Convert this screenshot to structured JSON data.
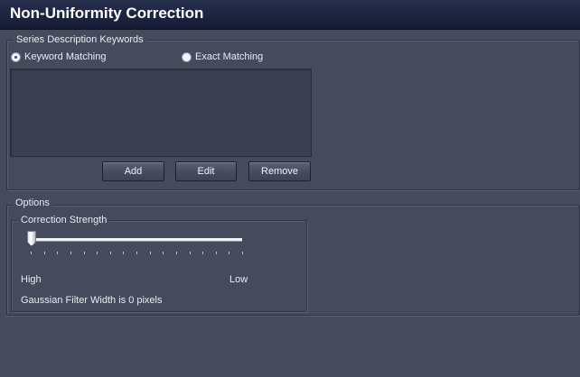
{
  "window": {
    "title": "Non-Uniformity Correction"
  },
  "keywords": {
    "group_label": "Series Description Keywords",
    "mode_options": [
      {
        "label": "Keyword Matching",
        "selected": true
      },
      {
        "label": "Exact Matching",
        "selected": false
      }
    ],
    "list_items": [],
    "buttons": {
      "add": "Add",
      "edit": "Edit",
      "remove": "Remove"
    }
  },
  "options": {
    "group_label": "Options",
    "correction_strength": {
      "group_label": "Correction Strength",
      "slider_fraction": 0.0,
      "min_label": "High",
      "max_label": "Low"
    },
    "gaussian_text": "Gaussian Filter Width is 0 pixels"
  }
}
